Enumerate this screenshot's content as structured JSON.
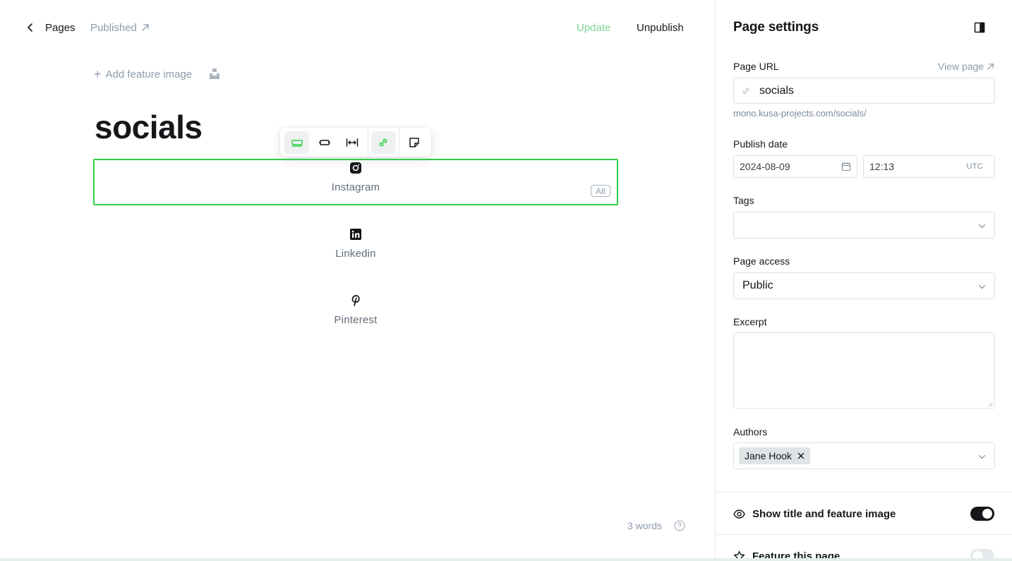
{
  "header": {
    "back_label": "Pages",
    "status_label": "Published",
    "update_label": "Update",
    "unpublish_label": "Unpublish"
  },
  "editor": {
    "add_feature_label": "Add feature image",
    "title": "socials",
    "alt_label": "Alt",
    "social_items": [
      {
        "label": "Instagram",
        "icon": "instagram-icon"
      },
      {
        "label": "Linkedin",
        "icon": "linkedin-icon"
      },
      {
        "label": "Pinterest",
        "icon": "pinterest-icon"
      }
    ],
    "word_count": "3 words"
  },
  "toolbar": {
    "buttons": [
      "width-regular-icon",
      "width-wide-icon",
      "width-full-icon",
      "link-icon",
      "caption-snippet-icon"
    ]
  },
  "settings": {
    "title": "Page settings",
    "page_url_label": "Page URL",
    "view_page_label": "View page",
    "slug": "socials",
    "url_hint": "mono.kusa-projects.com/socials/",
    "publish_date_label": "Publish date",
    "date_value": "2024-08-09",
    "time_value": "12:13",
    "timezone": "UTC",
    "tags_label": "Tags",
    "tags_value": "",
    "page_access_label": "Page access",
    "page_access_value": "Public",
    "excerpt_label": "Excerpt",
    "excerpt_value": "",
    "authors_label": "Authors",
    "author_name": "Jane Hook",
    "show_title_label": "Show title and feature image",
    "show_title_on": true,
    "feature_page_label": "Feature this page",
    "feature_page_on": false
  },
  "colors": {
    "accent_green": "#30cf43",
    "update_green": "#7ed494",
    "muted_text": "#8e9cac"
  }
}
